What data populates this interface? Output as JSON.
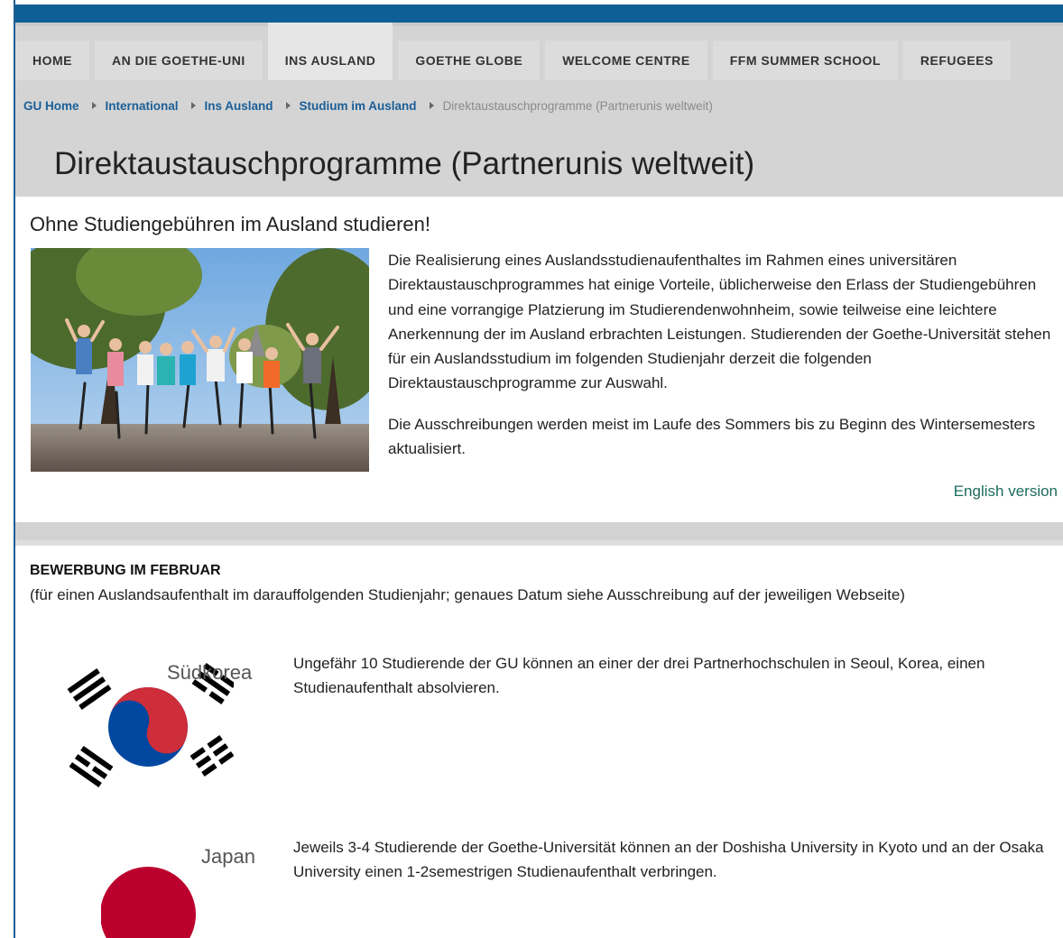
{
  "nav": {
    "items": [
      {
        "label": "HOME"
      },
      {
        "label": "AN DIE GOETHE-UNI"
      },
      {
        "label": "INS AUSLAND"
      },
      {
        "label": "GOETHE GLOBE"
      },
      {
        "label": "WELCOME CENTRE"
      },
      {
        "label": "FFM SUMMER SCHOOL"
      },
      {
        "label": "REFUGEES"
      }
    ],
    "active": "INS AUSLAND"
  },
  "breadcrumb": {
    "items": [
      "GU Home",
      "International",
      "Ins Ausland",
      "Studium im Ausland"
    ],
    "current": "Direktaustauschprogramme (Partnerunis weltweit)"
  },
  "page": {
    "title": "Direktaustauschprogramme (Partnerunis weltweit)"
  },
  "intro": {
    "heading": "Ohne Studiengebühren im Ausland studieren!",
    "paragraph1": "Die Realisierung eines Auslandsstudienaufenthaltes im Rahmen eines universitären Direktaustauschprogrammes hat einige Vorteile, üblicherweise den Erlass der Studiengebühren und eine vorrangige Platzierung im Studierendenwohnheim, sowie teilweise eine leichtere Anerkennung der im Ausland erbrachten Leistungen. Studierenden der Goethe-Universität stehen für ein Auslandsstudium im folgenden Studienjahr derzeit die folgenden Direktaustauschprogramme zur Auswahl.",
    "paragraph2": "Die Ausschreibungen werden meist im Laufe des Sommers bis zu Beginn des Wintersemesters aktualisiert.",
    "english_link": "English version"
  },
  "section": {
    "heading": "BEWERBUNG IM FEBRUAR",
    "subtitle": "(für einen Auslandsaufenthalt im darauffolgenden Studienjahr; genaues Datum siehe Ausschreibung auf der jeweiligen Webseite)"
  },
  "countries": [
    {
      "name": "Südkorea",
      "text": "Ungefähr 10 Studierende der GU können an einer der drei Partnerhochschulen in Seoul, Korea, einen Studienaufenthalt absolvieren.",
      "icon": "south-korea-flag-icon"
    },
    {
      "name": "Japan",
      "text": "Jeweils 3-4 Studierende der Goethe-Universität können an der Doshisha University in Kyoto und an der Osaka University einen 1-2semestrigen Studienaufenthalt verbringen.",
      "icon": "japan-flag-icon"
    }
  ],
  "colors": {
    "topbar": "#0e5f95",
    "link": "#1a5e96",
    "english_link": "#1d6b5e",
    "korea_red": "#cd2e3a",
    "korea_blue": "#0047a0",
    "japan_red": "#bc002d"
  }
}
